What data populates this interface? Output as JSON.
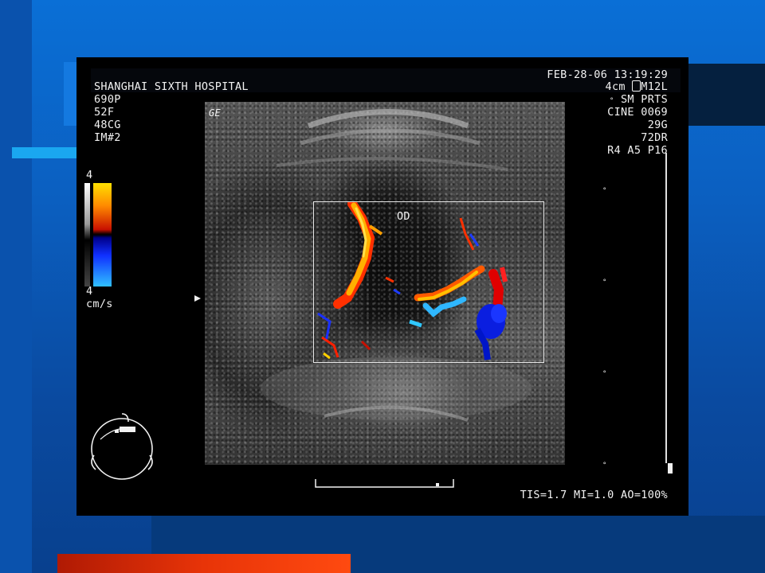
{
  "header": {
    "hospital": "SHANGHAI SIXTH HOSPITAL",
    "datetime": "FEB-28-06 13:19:29",
    "patient_lines": [
      "690P",
      "52F",
      "48CG",
      "IM#2"
    ]
  },
  "probe": {
    "depth": "4cm",
    "probe_id": "M12L",
    "mode": "SM PRTS",
    "cine": "CINE 0069",
    "gain": "29G",
    "dynamic_range": "72DR",
    "settings": "R4 A5 P16"
  },
  "image": {
    "vendor_mark": "GE",
    "region_label": "OD"
  },
  "color_scale": {
    "top": "4",
    "bottom": "4",
    "unit": "cm/s"
  },
  "footer": {
    "metrics": "TIS=1.7 MI=1.0 AO=100%"
  }
}
